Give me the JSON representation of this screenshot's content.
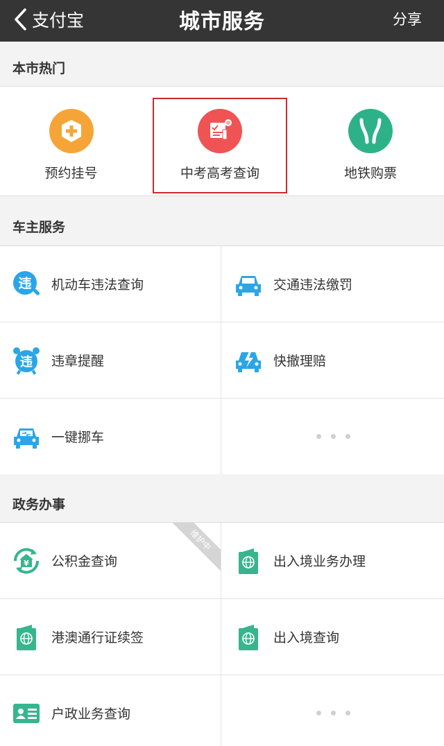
{
  "nav": {
    "back_label": "支付宝",
    "title": "城市服务",
    "share_label": "分享"
  },
  "hot": {
    "header": "本市热门",
    "items": [
      {
        "label": "预约挂号",
        "icon": "hospital-plus-icon",
        "color": "#f5a537"
      },
      {
        "label": "中考高考查询",
        "icon": "exam-certificate-icon",
        "color": "#ef5353"
      },
      {
        "label": "地铁购票",
        "icon": "metro-icon",
        "color": "#2db287"
      }
    ]
  },
  "car": {
    "header": "车主服务",
    "items": [
      {
        "label": "机动车违法查询",
        "icon": "violation-search-icon"
      },
      {
        "label": "交通违法缴罚",
        "icon": "car-fine-icon"
      },
      {
        "label": "违章提醒",
        "icon": "violation-alarm-icon"
      },
      {
        "label": "快撤理赔",
        "icon": "car-claim-icon"
      },
      {
        "label": "一键挪车",
        "icon": "move-car-icon"
      }
    ],
    "violation_char": "违"
  },
  "gov": {
    "header": "政务办事",
    "maintenance_badge": "维护中",
    "items": [
      {
        "label": "公积金查询",
        "icon": "housing-fund-icon"
      },
      {
        "label": "出入境业务办理",
        "icon": "passport-icon"
      },
      {
        "label": "港澳通行证续签",
        "icon": "passport-icon"
      },
      {
        "label": "出入境查询",
        "icon": "passport-icon"
      },
      {
        "label": "户政业务查询",
        "icon": "id-card-icon"
      }
    ],
    "yen_char": "¥"
  },
  "colors": {
    "blue": "#2aa6e6",
    "green": "#37b58c",
    "navbar": "#353535",
    "highlight": "#c9282d"
  }
}
